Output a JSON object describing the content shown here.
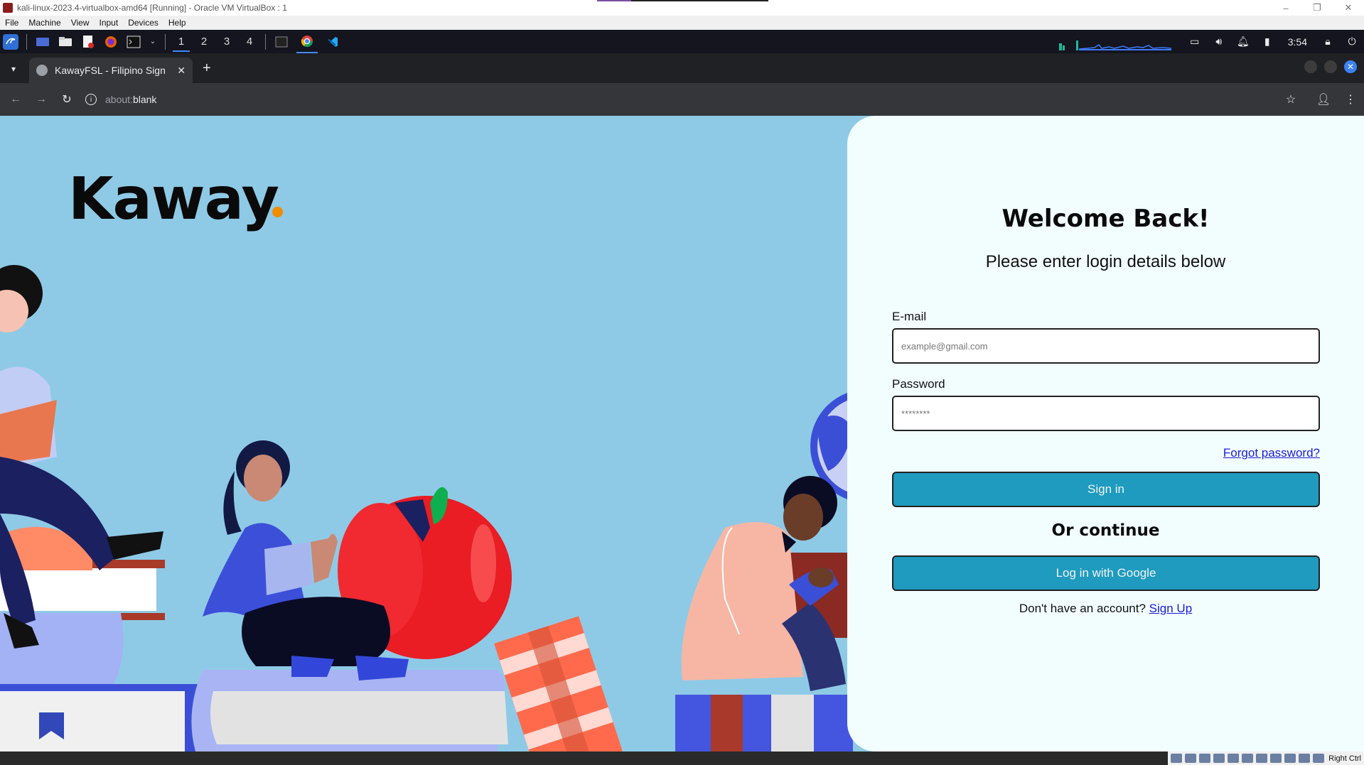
{
  "vm_window": {
    "title": "kali-linux-2023.4-virtualbox-amd64 [Running] - Oracle VM VirtualBox : 1",
    "menu": [
      "File",
      "Machine",
      "View",
      "Input",
      "Devices",
      "Help"
    ],
    "controls": [
      "–",
      "❐",
      "✕"
    ]
  },
  "taskbar": {
    "workspaces": [
      "1",
      "2",
      "3",
      "4"
    ],
    "active_workspace": "1",
    "clock": "3:54",
    "icons": [
      "kali-menu-icon",
      "desktop-icon",
      "file-manager-icon",
      "text-editor-icon",
      "firefox-icon",
      "terminal-icon",
      "chrome-icon",
      "vscode-icon"
    ]
  },
  "browser": {
    "tab_title": "KawayFSL - Filipino Sign",
    "url_scheme": "about:",
    "url_path": "blank"
  },
  "page": {
    "logo": "Kaway",
    "welcome": "Welcome Back!",
    "subtitle": "Please enter login details below",
    "email_label": "E-mail",
    "email_placeholder": "example@gmail.com",
    "password_label": "Password",
    "password_placeholder": "********",
    "forgot": "Forgot password?",
    "sign_in": "Sign in",
    "or_continue": "Or continue",
    "google": "Log in with Google",
    "no_account": "Don't have an account? ",
    "sign_up": "Sign Up"
  },
  "statusbar": {
    "host_key": "Right Ctrl"
  },
  "colors": {
    "background": "#8ecae6",
    "panel": "#f2fefe",
    "button": "#1e9bbf",
    "logo_dot": "#f08c00",
    "link": "#1a1adb"
  }
}
